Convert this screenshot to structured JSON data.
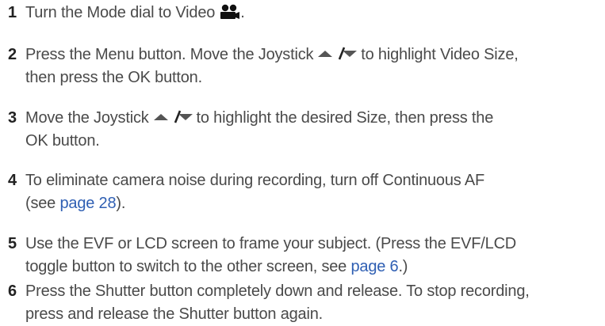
{
  "steps": [
    {
      "num": "1",
      "text_a": "Turn the Mode dial to Video",
      "text_b": ".",
      "icon": "video-camera-icon"
    },
    {
      "num": "2",
      "text_a": "Press the Menu button. Move the Joystick",
      "text_b": "to highlight Video Size,",
      "text_c": "then press the OK button.",
      "icon": "up-down-arrows-icon"
    },
    {
      "num": "3",
      "text_a": "Move the Joystick",
      "text_b": "to highlight the desired Size, then press the",
      "text_c": "OK button.",
      "icon": "up-down-arrows-icon"
    },
    {
      "num": "4",
      "text_a": "To eliminate camera noise during recording, turn off Continuous AF",
      "text_b": "(see ",
      "link": "page 28",
      "text_c": ")."
    },
    {
      "num": "5",
      "text_a": "Use the EVF or LCD screen to frame your subject. (Press the EVF/LCD",
      "text_b": "toggle button to switch to the other screen, see ",
      "link": "page 6",
      "text_c": ".)"
    },
    {
      "num": "6",
      "text_a": "Press the Shutter button completely down and release. To stop recording,",
      "text_b": "press and release the Shutter button again."
    }
  ],
  "colors": {
    "text": "#4a4a4a",
    "number": "#222222",
    "link": "#2f5fb3"
  }
}
